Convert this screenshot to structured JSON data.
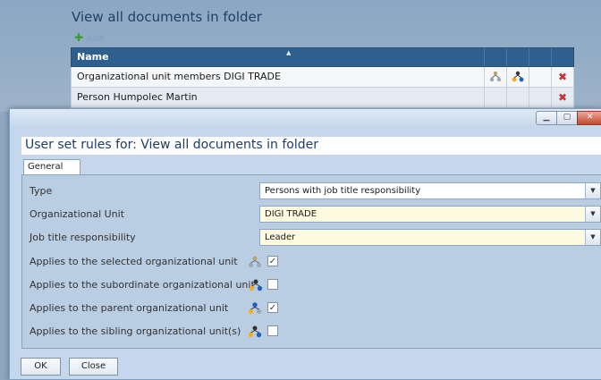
{
  "background": {
    "title": "View all documents in folder",
    "add_label": "Add",
    "table": {
      "header_name": "Name",
      "rows": [
        {
          "name": "Organizational unit members DIGI TRADE"
        },
        {
          "name": "Person Humpolec Martin"
        }
      ]
    }
  },
  "dialog": {
    "heading": "User set rules for: View all documents in folder",
    "tab_label": "General",
    "fields": {
      "type": {
        "label": "Type",
        "value": "Persons with job title responsibility"
      },
      "org_unit": {
        "label": "Organizational Unit",
        "value": "DIGI TRADE"
      },
      "job_title": {
        "label": "Job title responsibility",
        "value": "Leader"
      }
    },
    "checkboxes": [
      {
        "label": "Applies to the selected organizational unit",
        "checked": true
      },
      {
        "label": "Applies to the subordinate organizational unit",
        "checked": false
      },
      {
        "label": "Applies to the parent organizational unit",
        "checked": true
      },
      {
        "label": "Applies to the sibling organizational unit(s)",
        "checked": false
      }
    ],
    "buttons": {
      "ok": "OK",
      "close": "Close"
    }
  },
  "icons": {
    "org_unit_icon": "org-unit-icon",
    "delete_icon": "delete-icon",
    "add_icon": "plus-icon",
    "dropdown_icon": "chevron-down-icon",
    "check_icon": "checkmark-icon"
  },
  "colors": {
    "header_blue": "#2f5f8c",
    "dialog_bg": "#c4d7ec",
    "close_red": "#c4472f"
  }
}
